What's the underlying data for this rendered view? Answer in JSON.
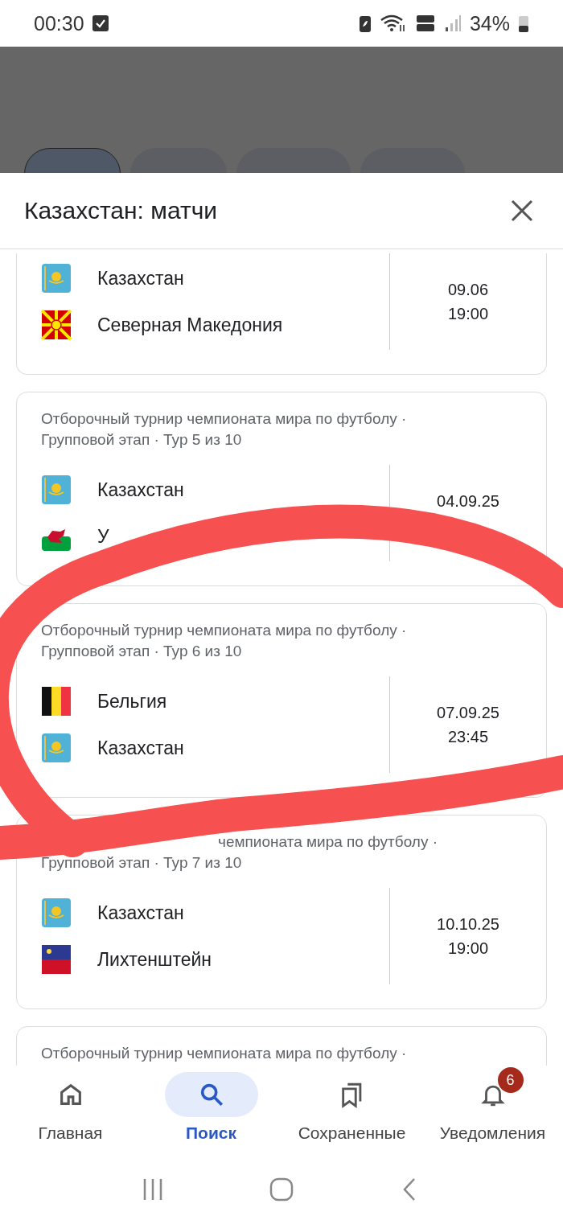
{
  "status_bar": {
    "time": "00:30",
    "battery": "34%"
  },
  "tabs": [
    {
      "selected": true
    },
    {
      "selected": false
    },
    {
      "selected": false
    },
    {
      "selected": false
    }
  ],
  "sheet": {
    "title": "Казахстан: матчи"
  },
  "matches": [
    {
      "teams": [
        {
          "name": "Казахстан",
          "kind": "kz"
        },
        {
          "name": "Северная Македония",
          "kind": "mk"
        }
      ],
      "date": "09.06",
      "time": "19:00"
    },
    {
      "title_lines": [
        "Отборочный турнир чемпионата мира по футболу ·",
        "Групповой этап · Тур 5 из 10"
      ],
      "teams": [
        {
          "name": "Казахстан",
          "kind": "kz"
        },
        {
          "name": "У",
          "kind": "wal"
        }
      ],
      "date": "04.09.25"
    },
    {
      "title_lines": [
        "Отборочный турнир чемпионата мира по футболу ·",
        "Групповой этап · Тур 6 из 10"
      ],
      "teams": [
        {
          "name": "Бельгия",
          "kind": "be"
        },
        {
          "name": "Казахстан",
          "kind": "kz"
        }
      ],
      "date": "07.09.25",
      "time": "23:45"
    },
    {
      "title_lines": [
        "чемпионата мира по футболу ·",
        "Групповой этап · Тур 7 из 10"
      ],
      "lead_covered": true,
      "teams": [
        {
          "name": "Казахстан",
          "kind": "kz"
        },
        {
          "name": "Лихтенштейн",
          "kind": "li"
        }
      ],
      "date": "10.10.25",
      "time": "19:00"
    },
    {
      "title_lines": [
        "Отборочный турнир чемпионата мира по футболу ·"
      ]
    }
  ],
  "bottom_nav": [
    {
      "label": "Главная",
      "selected": false
    },
    {
      "label": "Поиск",
      "selected": true
    },
    {
      "label": "Сохраненные",
      "selected": false
    },
    {
      "label": "Уведомления",
      "selected": false,
      "badge": "6"
    }
  ]
}
